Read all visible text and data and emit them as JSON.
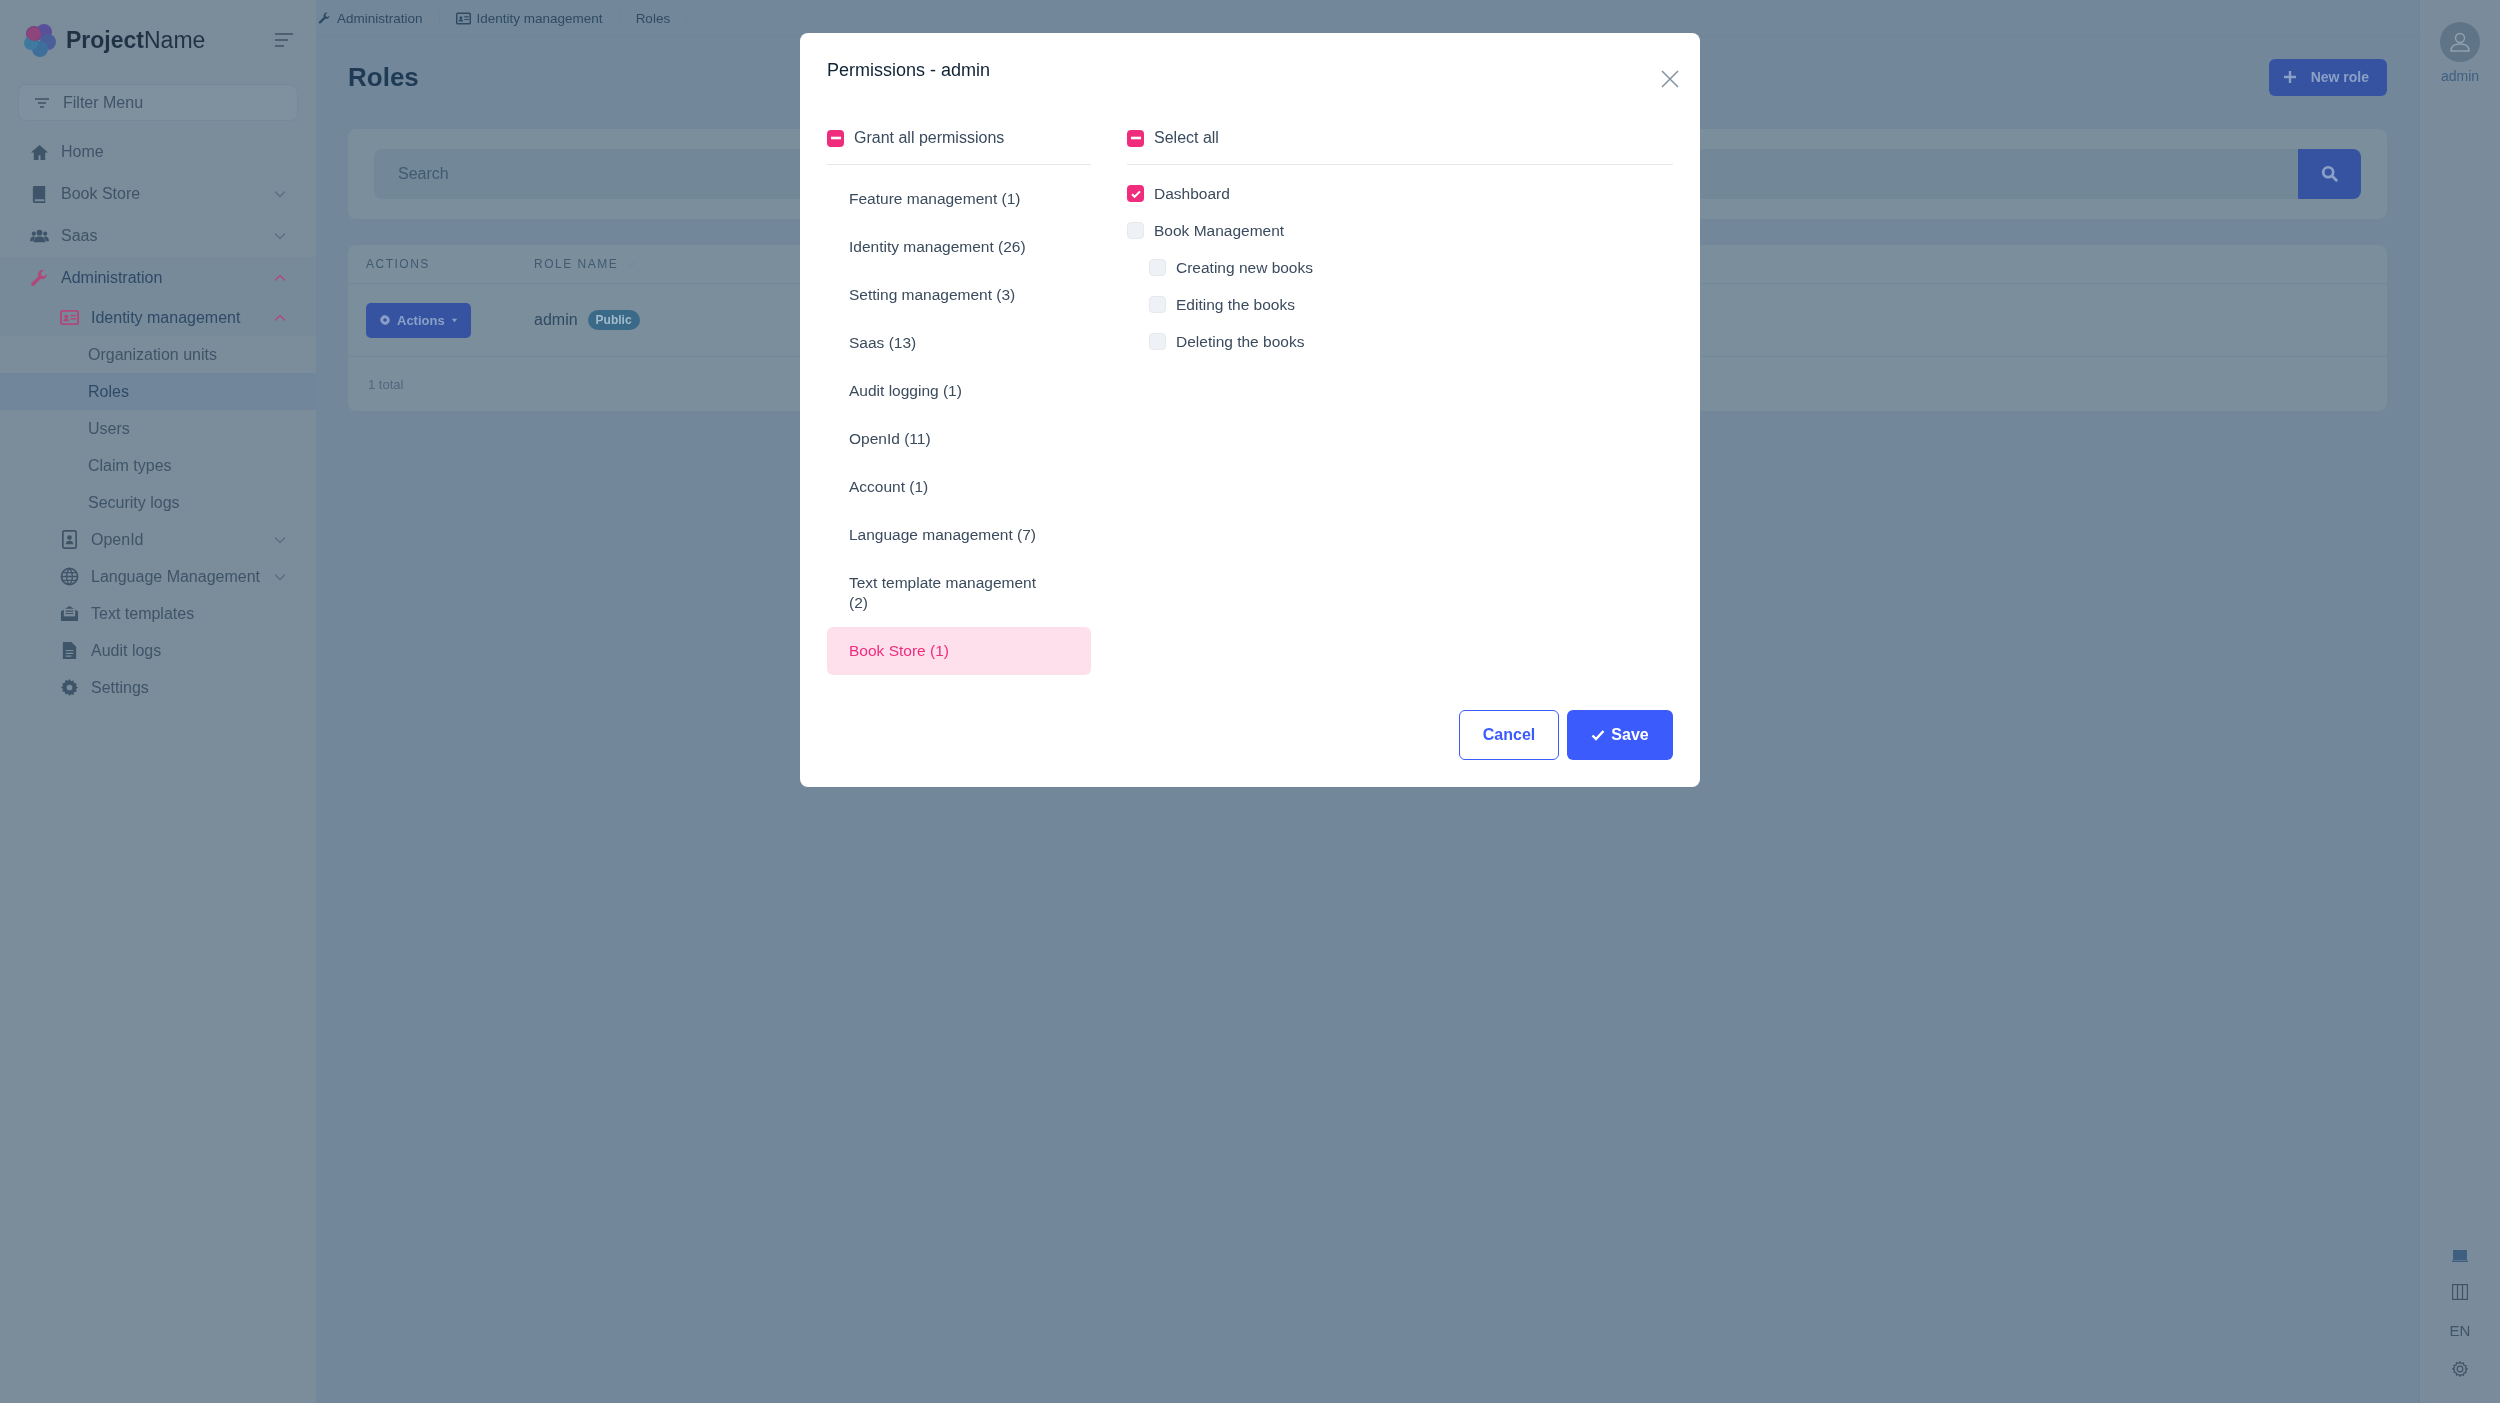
{
  "app": {
    "name": "**Project**Name"
  },
  "sidebar": {
    "filter_placeholder": "Filter Menu",
    "items": [
      {
        "label": "Home",
        "selected": false
      },
      {
        "label": "Book Store",
        "selected": false,
        "expanded": false
      },
      {
        "label": "Saas",
        "selected": false,
        "expanded": false
      },
      {
        "label": "Administration",
        "selected": false,
        "expanded": true,
        "children": [
          {
            "label": "Identity management",
            "selected": false,
            "expanded": true,
            "children": [
              {
                "label": "Organization units",
                "selected": false
              },
              {
                "label": "Roles",
                "selected": true
              },
              {
                "label": "Users",
                "selected": false
              },
              {
                "label": "Claim types",
                "selected": false
              },
              {
                "label": "Security logs",
                "selected": false
              }
            ]
          },
          {
            "label": "OpenId",
            "selected": false,
            "expanded": false
          },
          {
            "label": "Language Management",
            "selected": false,
            "expanded": false
          },
          {
            "label": "Text templates",
            "selected": false
          },
          {
            "label": "Audit logs",
            "selected": false
          },
          {
            "label": "Settings",
            "selected": false
          }
        ]
      }
    ]
  },
  "breadcrumb": [
    "Administration",
    "Identity management",
    "Roles"
  ],
  "page": {
    "title": "Roles",
    "new_button": "New role",
    "search": {
      "placeholder": "Search"
    },
    "table": {
      "columns": [
        "ACTIONS",
        "ROLE NAME"
      ],
      "rows": [
        {
          "actions": "Actions",
          "name": "admin",
          "badge": "Public"
        }
      ],
      "footer": "1 total"
    }
  },
  "user": {
    "name": "admin"
  },
  "rail": {
    "language": "EN"
  },
  "modal": {
    "title": "Permissions - admin",
    "grant_all": {
      "label": "Grant all permissions",
      "indeterminate": true
    },
    "groups": [
      {
        "label": "Feature management (1)",
        "selected": false
      },
      {
        "label": "Identity management (26)",
        "selected": false
      },
      {
        "label": "Setting management (3)",
        "selected": false
      },
      {
        "label": "Saas (13)",
        "selected": false
      },
      {
        "label": "Audit logging (1)",
        "selected": false
      },
      {
        "label": "OpenId (11)",
        "selected": false
      },
      {
        "label": "Account (1)",
        "selected": false
      },
      {
        "label": "Language management (7)",
        "selected": false
      },
      {
        "label": "Text template management (2)",
        "selected": false
      },
      {
        "label": "Book Store (1)",
        "selected": true
      }
    ],
    "select_all": {
      "label": "Select all",
      "indeterminate": true
    },
    "permissions": [
      {
        "label": "Dashboard",
        "checked": true
      },
      {
        "label": "Book Management",
        "checked": false,
        "children": [
          {
            "label": "Creating new books",
            "checked": false
          },
          {
            "label": "Editing the books",
            "checked": false
          },
          {
            "label": "Deleting the books",
            "checked": false
          }
        ]
      }
    ],
    "buttons": {
      "cancel": "Cancel",
      "save": "Save"
    }
  }
}
